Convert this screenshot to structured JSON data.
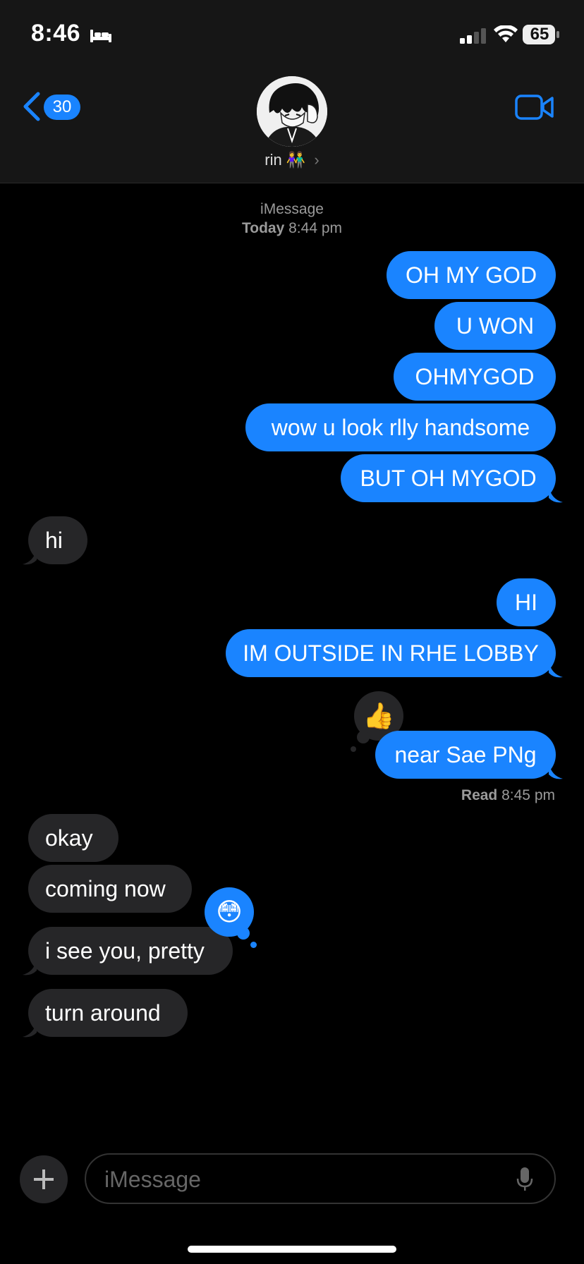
{
  "status_bar": {
    "time": "8:46",
    "battery": "65"
  },
  "header": {
    "back_count": "30",
    "contact_name": "rin",
    "contact_emoji": "👫",
    "chevron": "›"
  },
  "thread": {
    "service": "iMessage",
    "day": "Today",
    "time": "8:44 pm"
  },
  "messages": {
    "m1": "OH MY GOD",
    "m2": "U WON",
    "m3": "OHMYGOD",
    "m4": "wow u look rlly handsome",
    "m5": "BUT OH MYGOD",
    "m6": "hi",
    "m7": "HI",
    "m8": "IM OUTSIDE IN RHE LOBBY",
    "m9": "near Sae PNg",
    "m10": "okay",
    "m11": "coming now",
    "m12": "i see you, pretty",
    "m13": "turn around"
  },
  "reactions": {
    "thumbs": "👍",
    "flushed": "😳"
  },
  "read_receipt": {
    "label": "Read",
    "time": "8:45 pm"
  },
  "compose": {
    "placeholder": "iMessage"
  },
  "colors": {
    "sent_bubble": "#1a84ff",
    "received_bubble": "#262628",
    "background": "#000000"
  }
}
